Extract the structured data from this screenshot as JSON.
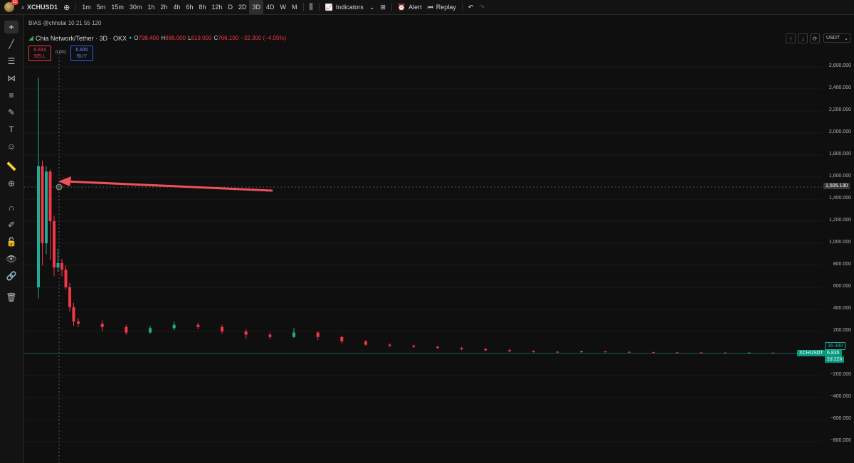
{
  "topbar": {
    "notification_count": "11",
    "symbol": "XCHUSD1",
    "intervals": [
      "1m",
      "5m",
      "15m",
      "30m",
      "1h",
      "2h",
      "4h",
      "6h",
      "8h",
      "12h",
      "D",
      "2D",
      "3D",
      "4D",
      "W",
      "M"
    ],
    "active_interval": "3D",
    "indicators_label": "Indicators",
    "alert_label": "Alert",
    "replay_label": "Replay"
  },
  "legend": {
    "indicator": "BIAS @chhslai 10 21 55 120",
    "title": "Chia Network/Tether · 3D · OKX",
    "open_label": "O",
    "open": "798.400",
    "high_label": "H",
    "high": "888.000",
    "low_label": "L",
    "low": "613.000",
    "close_label": "C",
    "close": "766.100",
    "change": "−32.300 (−4.05%)"
  },
  "trade": {
    "sell_price": "6.834",
    "sell_label": "SELL",
    "spread": "0.001",
    "buy_price": "6.835",
    "buy_label": "BUY"
  },
  "currency": "USDT",
  "axis": {
    "labels": [
      "2,600.000",
      "2,400.000",
      "2,200.000",
      "2,000.000",
      "1,800.000",
      "1,600.000",
      "1,400.000",
      "1,200.000",
      "1,000.000",
      "800.000",
      "600.000",
      "400.000",
      "200.000",
      "−200.000",
      "−400.000",
      "−600.000",
      "−800.000"
    ],
    "crosshair_price": "1,505.130",
    "ma_value": "36.380",
    "last_symbol": "XCHUSDT",
    "last_price": "6.835",
    "countdown": "2d 22h"
  },
  "chart_data": {
    "type": "candlestick",
    "ylim": [
      -800,
      2700
    ],
    "candles": [
      {
        "o": 600,
        "c": 1700,
        "h": 2500,
        "l": 500
      },
      {
        "o": 1700,
        "c": 1000,
        "h": 1750,
        "l": 800
      },
      {
        "o": 1000,
        "c": 1650,
        "h": 1700,
        "l": 900
      },
      {
        "o": 1650,
        "c": 1200,
        "h": 1670,
        "l": 850
      },
      {
        "o": 1200,
        "c": 780,
        "h": 1250,
        "l": 700
      },
      {
        "o": 780,
        "c": 820,
        "h": 950,
        "l": 740
      },
      {
        "o": 820,
        "c": 760,
        "h": 860,
        "l": 700
      },
      {
        "o": 760,
        "c": 600,
        "h": 800,
        "l": 580
      },
      {
        "o": 600,
        "c": 420,
        "h": 640,
        "l": 380
      },
      {
        "o": 420,
        "c": 290,
        "h": 460,
        "l": 250
      },
      {
        "o": 290,
        "c": 270,
        "h": 320,
        "l": 240
      },
      {
        "o": 270,
        "c": 240,
        "h": 300,
        "l": 200
      },
      {
        "o": 240,
        "c": 190,
        "h": 260,
        "l": 170
      },
      {
        "o": 190,
        "c": 230,
        "h": 250,
        "l": 180
      },
      {
        "o": 230,
        "c": 260,
        "h": 290,
        "l": 210
      },
      {
        "o": 260,
        "c": 240,
        "h": 280,
        "l": 220
      },
      {
        "o": 240,
        "c": 200,
        "h": 260,
        "l": 180
      },
      {
        "o": 200,
        "c": 170,
        "h": 220,
        "l": 130
      },
      {
        "o": 170,
        "c": 150,
        "h": 190,
        "l": 130
      },
      {
        "o": 150,
        "c": 190,
        "h": 230,
        "l": 140
      },
      {
        "o": 190,
        "c": 150,
        "h": 200,
        "l": 120
      },
      {
        "o": 150,
        "c": 110,
        "h": 160,
        "l": 90
      },
      {
        "o": 110,
        "c": 80,
        "h": 120,
        "l": 70
      },
      {
        "o": 80,
        "c": 70,
        "h": 90,
        "l": 60
      },
      {
        "o": 70,
        "c": 60,
        "h": 80,
        "l": 50
      },
      {
        "o": 60,
        "c": 50,
        "h": 70,
        "l": 40
      },
      {
        "o": 50,
        "c": 40,
        "h": 60,
        "l": 30
      },
      {
        "o": 40,
        "c": 30,
        "h": 50,
        "l": 20
      },
      {
        "o": 30,
        "c": 20,
        "h": 40,
        "l": 10
      },
      {
        "o": 20,
        "c": 15,
        "h": 30,
        "l": 8
      },
      {
        "o": 15,
        "c": 12,
        "h": 22,
        "l": 8
      },
      {
        "o": 12,
        "c": 18,
        "h": 25,
        "l": 10
      },
      {
        "o": 18,
        "c": 14,
        "h": 22,
        "l": 10
      },
      {
        "o": 14,
        "c": 12,
        "h": 18,
        "l": 8
      },
      {
        "o": 12,
        "c": 10,
        "h": 16,
        "l": 8
      },
      {
        "o": 10,
        "c": 9,
        "h": 14,
        "l": 6
      },
      {
        "o": 9,
        "c": 8,
        "h": 12,
        "l": 6
      },
      {
        "o": 8,
        "c": 7,
        "h": 10,
        "l": 5
      },
      {
        "o": 7,
        "c": 7.5,
        "h": 10,
        "l": 5
      },
      {
        "o": 7.5,
        "c": 6.835,
        "h": 9,
        "l": 6
      }
    ]
  }
}
